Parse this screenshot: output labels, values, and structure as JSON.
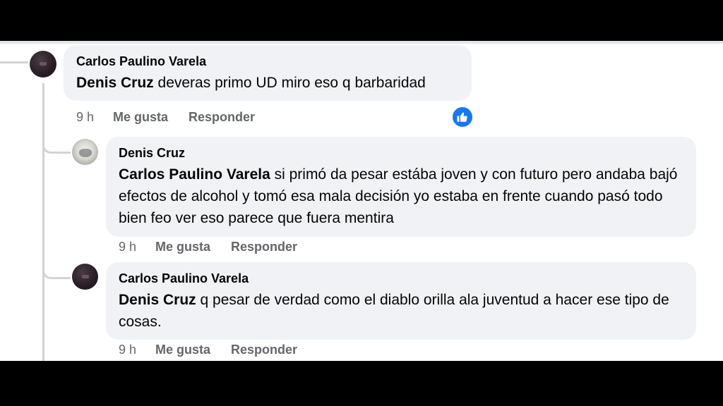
{
  "comments": [
    {
      "author": "Carlos Paulino Varela",
      "mention": "Denis Cruz",
      "text": " deveras primo UD miro eso q barbaridad",
      "time": "9 h",
      "like": "Me gusta",
      "reply": "Responder",
      "reaction": "like-icon"
    },
    {
      "author": "Denis Cruz",
      "mention": "Carlos Paulino Varela",
      "text": " si primó da pesar estába joven y con futuro pero andaba bajó efectos de alcohol y tomó esa mala decisión yo estaba en frente cuando pasó todo bien feo ver eso parece que fuera mentira",
      "time": "9 h",
      "like": "Me gusta",
      "reply": "Responder"
    },
    {
      "author": "Carlos Paulino Varela",
      "mention": "Denis Cruz",
      "text": " q pesar de verdad como el diablo orilla ala juventud a hacer ese tipo de cosas.",
      "time": "9 h",
      "like": "Me gusta",
      "reply": "Responder"
    }
  ],
  "colors": {
    "bubble": "#f0f2f5",
    "meta": "#65676b",
    "like_blue": "#1877f2",
    "thread_line": "#d0d3d8"
  }
}
